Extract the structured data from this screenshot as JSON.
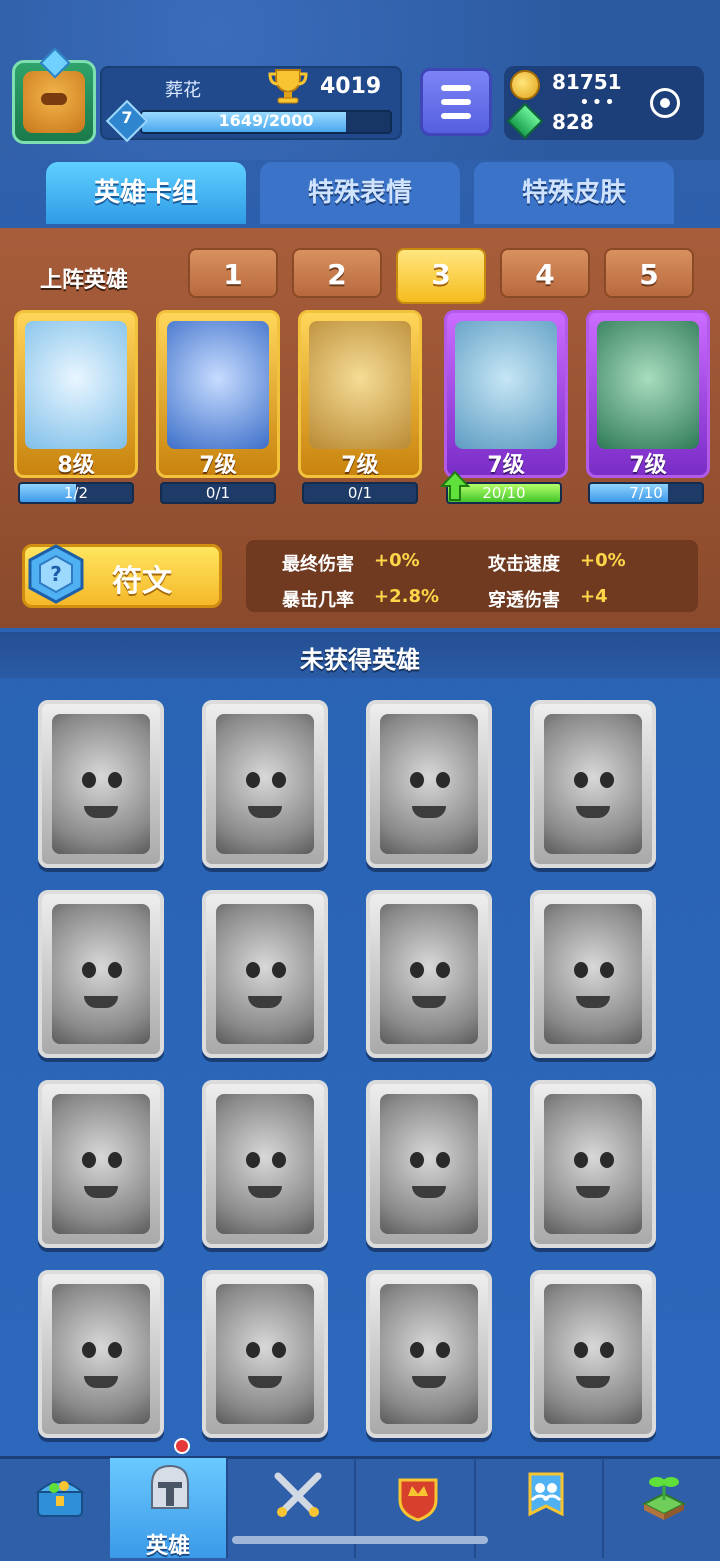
{
  "player": {
    "name": "葬花",
    "trophies": "4019",
    "level": "7",
    "xp_text": "1649/2000",
    "xp_fraction": 0.8245
  },
  "currency": {
    "coins": "81751",
    "gems": "828"
  },
  "tabs": [
    {
      "label": "英雄卡组",
      "active": true
    },
    {
      "label": "特殊表情",
      "active": false
    },
    {
      "label": "特殊皮肤",
      "active": false
    }
  ],
  "lineup": {
    "label": "上阵英雄",
    "slots": [
      "1",
      "2",
      "3",
      "4",
      "5"
    ],
    "active_slot": "3"
  },
  "heroes": [
    {
      "level": "8级",
      "progress": "1/2",
      "fraction": 0.5,
      "rarity": "gold",
      "color": "#9fd8ff"
    },
    {
      "level": "7级",
      "progress": "0/1",
      "fraction": 0.0,
      "rarity": "gold",
      "color": "#5a8fe0"
    },
    {
      "level": "7级",
      "progress": "0/1",
      "fraction": 0.0,
      "rarity": "gold",
      "color": "#e0b95a"
    },
    {
      "level": "7级",
      "progress": "20/10",
      "fraction": 1.0,
      "rarity": "purple",
      "color": "#7cc4e8",
      "upgradable": true
    },
    {
      "level": "7级",
      "progress": "7/10",
      "fraction": 0.7,
      "rarity": "purple",
      "color": "#4aa37a"
    }
  ],
  "rune": {
    "label": "符文",
    "stats": [
      {
        "label": "最终伤害",
        "value": "+0%"
      },
      {
        "label": "攻击速度",
        "value": "+0%"
      },
      {
        "label": "暴击几率",
        "value": "+2.8%"
      },
      {
        "label": "穿透伤害",
        "value": "+4"
      }
    ]
  },
  "unobtained": {
    "title": "未获得英雄",
    "count": 16
  },
  "nav": [
    {
      "icon": "treasure-chest-icon",
      "label": ""
    },
    {
      "icon": "knight-helmet-icon",
      "label": "英雄",
      "active": true
    },
    {
      "icon": "crossed-swords-icon",
      "label": ""
    },
    {
      "icon": "crown-shield-icon",
      "label": ""
    },
    {
      "icon": "friends-banner-icon",
      "label": ""
    },
    {
      "icon": "sprout-icon",
      "label": ""
    }
  ]
}
